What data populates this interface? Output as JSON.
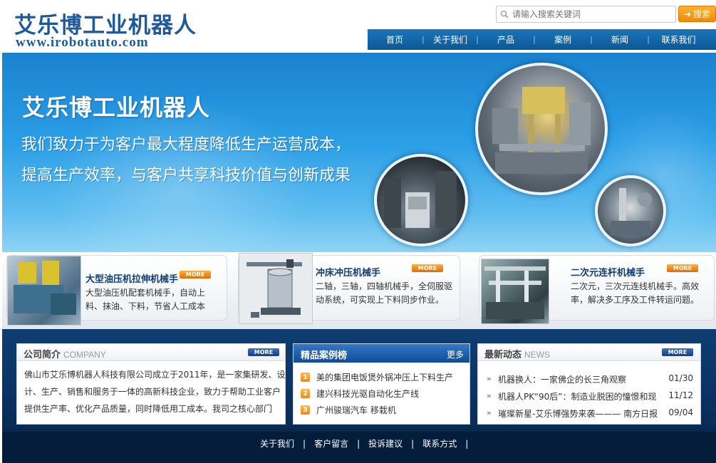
{
  "header": {
    "logo_cn": "艾乐博工业机器人",
    "logo_url": "www.irobotauto.com",
    "search_placeholder": "请输入搜索关键词",
    "search_button": "搜索"
  },
  "nav": [
    "首页",
    "关于我们",
    "产品",
    "案例",
    "新闻",
    "联系我们"
  ],
  "banner": {
    "title": "艾乐博工业机器人",
    "slogan": "我们致力于为客户最大程度降低生产运营成本，提高生产效率，与客户共享科技价值与创新成果"
  },
  "products": [
    {
      "title": "大型油压机拉伸机械手",
      "desc": "大型油压机配套机械手，自动上料、抹油、下料，节省人工成本",
      "more": "MORE"
    },
    {
      "title": "冲床冲压机械手",
      "desc": "二轴，三轴，四轴机械手，全伺服驱动系统，可实现上下料同步作业。",
      "more": "MORE"
    },
    {
      "title": "二次元连杆机械手",
      "desc": "二次元，三次元连线机械手。高效率，解决多工序及工件转运问题。",
      "more": "MORE"
    }
  ],
  "about": {
    "title": "公司简介",
    "title_en": "COMPANY",
    "more": "MORE",
    "text": "佛山市艾乐博机器人科技有限公司成立于2011年，是一家集研发、设计、生产、销售和服务于一体的高新科技企业，致力于帮助工业客户提供生产率、优化产品质量，同时降低用工成本。我司之核心部门"
  },
  "cases": {
    "title": "精品案例榜",
    "more": "更多",
    "items": [
      {
        "num": "1",
        "text": "美的集团电饭煲外锅冲压上下料生产"
      },
      {
        "num": "2",
        "text": "建兴科技光驱自动化生产线"
      },
      {
        "num": "3",
        "text": "广州骏瑞汽车 移栽机"
      }
    ]
  },
  "news": {
    "title": "最新动态",
    "title_en": "NEWS",
    "more": "MORE",
    "items": [
      {
        "title": "机器换人：一家佛企的长三角观察",
        "date": "01/30"
      },
      {
        "title": "机器人PK“90后”：制造业脱困的憧憬和现",
        "date": "11/12"
      },
      {
        "title": "璀璨新星-艾乐博强势来袭——— 南方日报",
        "date": "09/04"
      }
    ]
  },
  "footer": [
    "关于我们",
    "客户留言",
    "投诉建议",
    "联系方式"
  ]
}
